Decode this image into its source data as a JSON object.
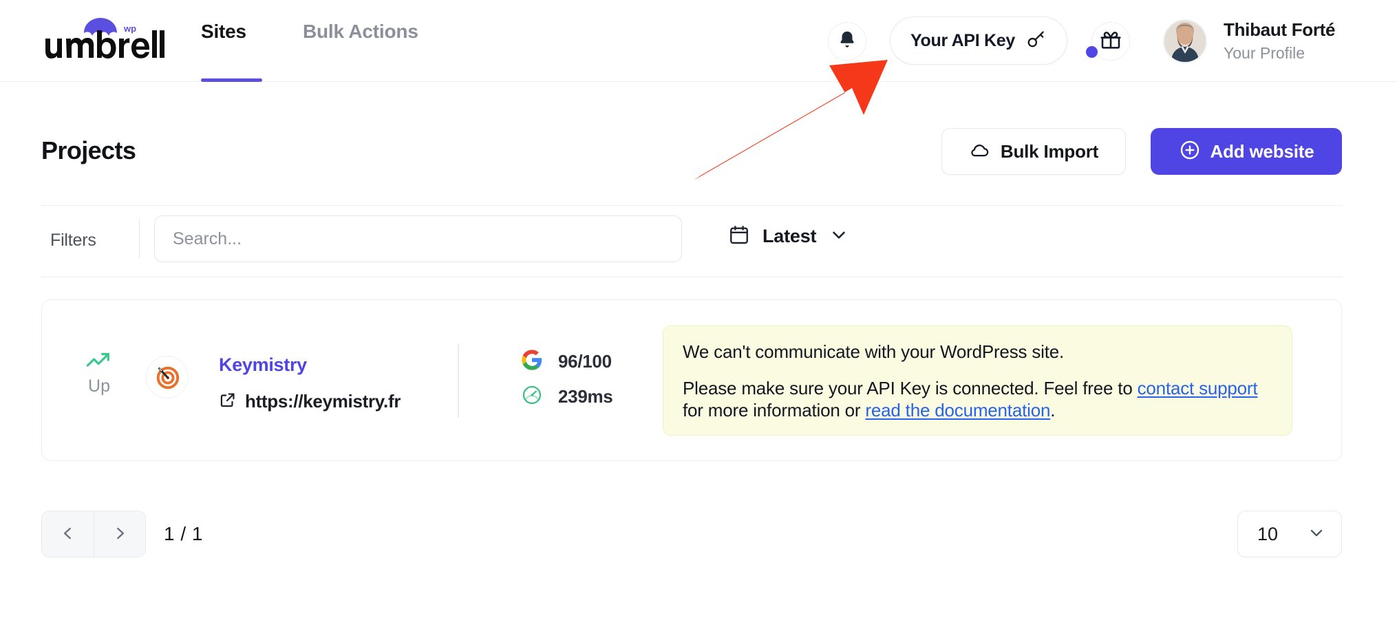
{
  "header": {
    "brand": {
      "name": "umbrella",
      "superscript": "wp",
      "icon": "umbrella-icon"
    },
    "nav": [
      {
        "label": "Sites",
        "active": true
      },
      {
        "label": "Bulk Actions",
        "active": false
      }
    ],
    "notifications_icon": "bell-icon",
    "api_key_button": {
      "label": "Your API Key",
      "icon": "key-icon"
    },
    "gift_icon": "gift-icon",
    "gift_badge": true,
    "profile": {
      "name": "Thibaut Forté",
      "subtitle": "Your Profile",
      "avatar": "user-avatar"
    }
  },
  "page": {
    "title": "Projects",
    "bulk_import_button": {
      "label": "Bulk Import",
      "icon": "cloud-icon"
    },
    "add_website_button": {
      "label": "Add website",
      "icon": "plus-circle-icon"
    }
  },
  "filters": {
    "label": "Filters",
    "search": {
      "value": "",
      "placeholder": "Search..."
    },
    "sort": {
      "label": "Latest",
      "icon": "calendar-icon",
      "chevron": "chevron-down-icon"
    }
  },
  "projects": [
    {
      "status": {
        "label": "Up",
        "icon": "trend-up-icon",
        "color": "#39c98a"
      },
      "favicon": "bullseye-target-icon",
      "name": "Keymistry",
      "url": "https://keymistry.fr",
      "url_icon": "external-link-icon",
      "metrics": [
        {
          "icon": "google-icon",
          "value": "96/100"
        },
        {
          "icon": "speedometer-icon",
          "value": "239ms"
        }
      ],
      "warning": {
        "title": "We can't communicate with your WordPress site.",
        "body_part1": "Please make sure your API Key is connected. Feel free to ",
        "link1": "contact support",
        "body_part2": " for more information or ",
        "link2": "read the documentation",
        "body_part3": "."
      }
    }
  ],
  "pagination": {
    "prev_icon": "chevron-left-icon",
    "next_icon": "chevron-right-icon",
    "count": "1 / 1",
    "per_page": {
      "value": "10",
      "chevron": "chevron-down-icon"
    }
  },
  "annotation": {
    "type": "arrow",
    "color": "#f6381a",
    "points_to": "api-key-button"
  },
  "colors": {
    "accent": "#4f45e4",
    "brand_purple": "#5b4fe0",
    "warning_bg": "#fbfbe2",
    "warning_border": "#f3f0bf",
    "link_blue": "#2563eb",
    "status_green": "#39c98a",
    "annotation_red": "#f6381a"
  }
}
